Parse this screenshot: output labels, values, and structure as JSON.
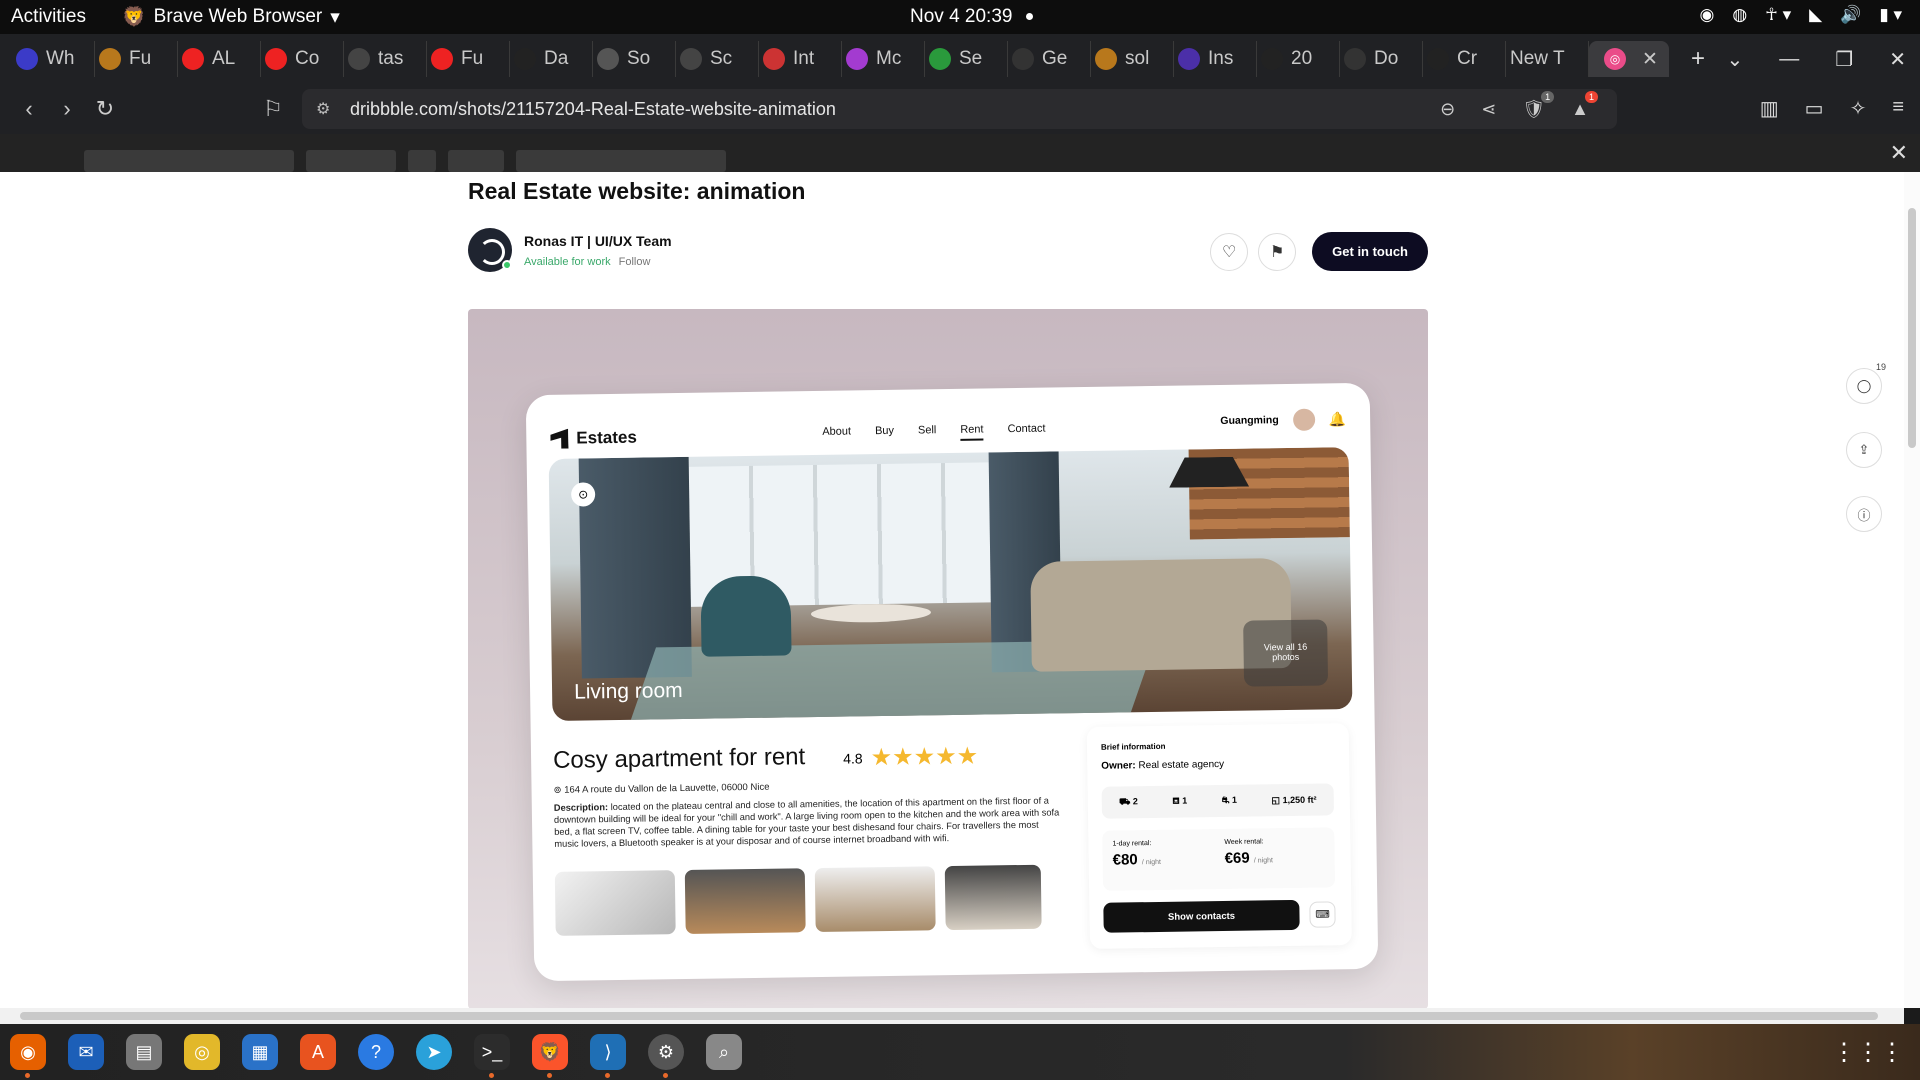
{
  "system": {
    "activities": "Activities",
    "app_name": "Brave Web Browser",
    "clock": "Nov 4  20:39"
  },
  "tabs": [
    {
      "label": "Wh",
      "color": "#3b3bc8"
    },
    {
      "label": "Fu",
      "color": "#b8781c"
    },
    {
      "label": "AL",
      "color": "#e22"
    },
    {
      "label": "Co",
      "color": "#e22"
    },
    {
      "label": "tas",
      "color": "#444"
    },
    {
      "label": "Fu",
      "color": "#e22"
    },
    {
      "label": "Da",
      "color": "#222"
    },
    {
      "label": "So",
      "color": "#555"
    },
    {
      "label": "Sc",
      "color": "#444"
    },
    {
      "label": "Int",
      "color": "#c33"
    },
    {
      "label": "Mc",
      "color": "#a33bd0"
    },
    {
      "label": "Se",
      "color": "#2a9a3c"
    },
    {
      "label": "Ge",
      "color": "#333"
    },
    {
      "label": "sol",
      "color": "#b8781c"
    },
    {
      "label": "Ins",
      "color": "#4b2fa8"
    },
    {
      "label": "20",
      "color": "#222"
    },
    {
      "label": "Do",
      "color": "#333"
    },
    {
      "label": "Cr",
      "color": "#222"
    },
    {
      "label": "New T",
      "color": "#202124"
    }
  ],
  "active_tab_color": "#ea4c89",
  "url": "dribbble.com/shots/21157204-Real-Estate-website-animation",
  "shields_count": "1",
  "rewards_count": "1",
  "shot": {
    "title": "Real Estate website: animation",
    "author": "Ronas IT | UI/UX Team",
    "availability": "Available for work",
    "follow": "Follow",
    "cta": "Get in touch",
    "comments_count": "19"
  },
  "mockup": {
    "brand": "Estates",
    "nav": [
      "About",
      "Buy",
      "Sell",
      "Rent",
      "Contact"
    ],
    "user": "Guangming",
    "hero_label": "Living room",
    "view_all": "View all 16 photos",
    "listing_title": "Cosy apartment for rent",
    "rating": "4.8",
    "stars": 5,
    "address": "164 A route du Vallon de la Lauvette, 06000 Nice",
    "description_label": "Description:",
    "description": "located on the plateau central and close to all amenities, the location of this apartment on the first floor of a downtown building will be ideal for your \"chill and work\". A large living room open to the kitchen and the work area with sofa bed, a flat screen TV, coffee table. A dining table for your taste your best dishesand four chairs. For travellers the most music lovers, a Bluetooth speaker is at your disposar and of course internet broadband with wifi.",
    "brief_title": "Brief information",
    "owner_label": "Owner:",
    "owner": "Real estate agency",
    "specs": [
      "2",
      "1",
      "1",
      "1,250 ft²"
    ],
    "day_label": "1-day rental:",
    "day_price": "€80",
    "day_unit": "/ night",
    "week_label": "Week rental:",
    "week_price": "€69",
    "week_unit": "/ night",
    "show_contacts": "Show contacts"
  }
}
